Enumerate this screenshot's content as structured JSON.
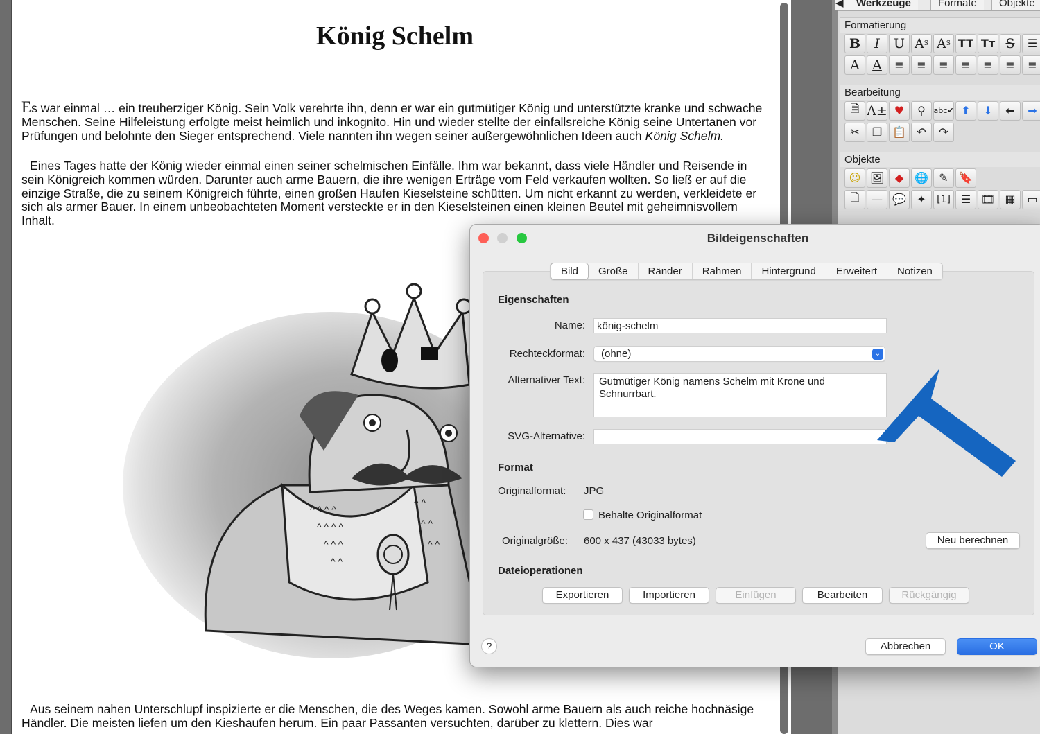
{
  "document": {
    "title": "König Schelm",
    "para1_dropcap": "E",
    "para1_text": "s war einmal … ein treuherziger König. Sein Volk verehrte ihn, denn er war ein gutmütiger König und unterstützte kranke und schwache Menschen. Seine Hilfeleistung erfolgte meist heimlich und inkognito. Hin und wieder stellte der einfallsreiche König seine Untertanen vor Prüfungen und belohnte den Sieger entsprechend. Viele nannten ihn wegen seiner außergewöhnlichen Ideen auch ",
    "para1_italic": "König Schelm.",
    "para2": "Eines Tages hatte der König wieder einmal einen seiner schelmischen Einfälle. Ihm war bekannt, dass viele Händler und Reisende in sein Königreich kommen würden. Darunter auch arme Bauern, die ihre wenigen Erträge vom Feld verkaufen wollten. So ließ er auf die einzige Straße, die zu seinem Königreich führte, einen großen Haufen Kieselsteine schütten. Um nicht erkannt zu werden, verkleidete er sich als armer Bauer. In einem unbeobachteten Moment versteckte er in den Kieselsteinen einen kleinen Beutel mit geheimnisvollem Inhalt.",
    "para3": "Aus seinem nahen Unterschlupf inspizierte er die Menschen, die des Weges kamen. Sowohl arme Bauern als auch reiche hochnäsige Händler. Die meisten liefen um den Kieshaufen herum. Ein paar Passanten versuchten, darüber zu klettern. Dies war"
  },
  "palette": {
    "tabs": [
      "Werkzeuge",
      "Formate",
      "Objekte"
    ],
    "sections": {
      "formatting": "Formatierung",
      "editing": "Bearbeitung",
      "objects": "Objekte"
    },
    "format_row1": [
      "B",
      "I",
      "U",
      "A",
      "A",
      "TT",
      "Tт",
      "S"
    ],
    "format_row2": [
      "A",
      "A"
    ],
    "object_footnote": "[1]"
  },
  "dialog": {
    "title": "Bildeigenschaften",
    "tabs": [
      "Bild",
      "Größe",
      "Ränder",
      "Rahmen",
      "Hintergrund",
      "Erweitert",
      "Notizen"
    ],
    "section_properties": "Eigenschaften",
    "name_label": "Name:",
    "name_value": "könig-schelm",
    "rect_label": "Rechteckformat:",
    "rect_value": "(ohne)",
    "alt_label": "Alternativer Text:",
    "alt_value": "Gutmütiger König namens Schelm mit Krone und Schnurrbart.",
    "svg_label": "SVG-Alternative:",
    "svg_value": "",
    "section_format": "Format",
    "orig_format_label": "Originalformat:",
    "orig_format_value": "JPG",
    "keep_format_label": "Behalte Originalformat",
    "keep_format_checked": false,
    "orig_size_label": "Originalgröße:",
    "orig_size_value": "600 x 437 (43033 bytes)",
    "recalc_button": "Neu berechnen",
    "section_file": "Dateioperationen",
    "file_buttons": {
      "export": "Exportieren",
      "import": "Importieren",
      "insert": "Einfügen",
      "edit": "Bearbeiten",
      "undo": "Rückgängig"
    },
    "help_button": "?",
    "cancel_button": "Abbrechen",
    "ok_button": "OK"
  },
  "colors": {
    "arrow": "#1565c0",
    "accent": "#2b73e6",
    "close": "#fe5f57",
    "minimize_inactive": "#d0d0d0"
  }
}
